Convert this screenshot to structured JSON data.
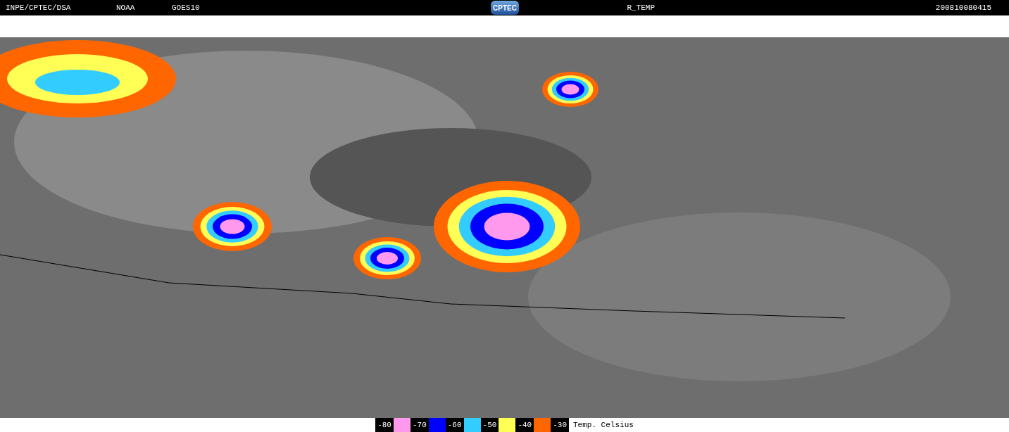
{
  "header": {
    "source": "INPE/CPTEC/DSA",
    "agency": "NOAA",
    "satellite": "GOES10",
    "logo": "CPTEC",
    "product": "R_TEMP",
    "timestamp": "200810080415"
  },
  "legend": {
    "items": [
      {
        "kind": "label",
        "text": "-80"
      },
      {
        "kind": "swatch",
        "color": "#ff99ee"
      },
      {
        "kind": "label",
        "text": "-70"
      },
      {
        "kind": "swatch",
        "color": "#0000ff"
      },
      {
        "kind": "label",
        "text": "-60"
      },
      {
        "kind": "swatch",
        "color": "#33ccff"
      },
      {
        "kind": "label",
        "text": "-50"
      },
      {
        "kind": "swatch",
        "color": "#ffff55"
      },
      {
        "kind": "label",
        "text": "-40"
      },
      {
        "kind": "swatch",
        "color": "#ff6600"
      },
      {
        "kind": "label",
        "text": "-30"
      }
    ],
    "unit": "Temp. Celsius"
  }
}
